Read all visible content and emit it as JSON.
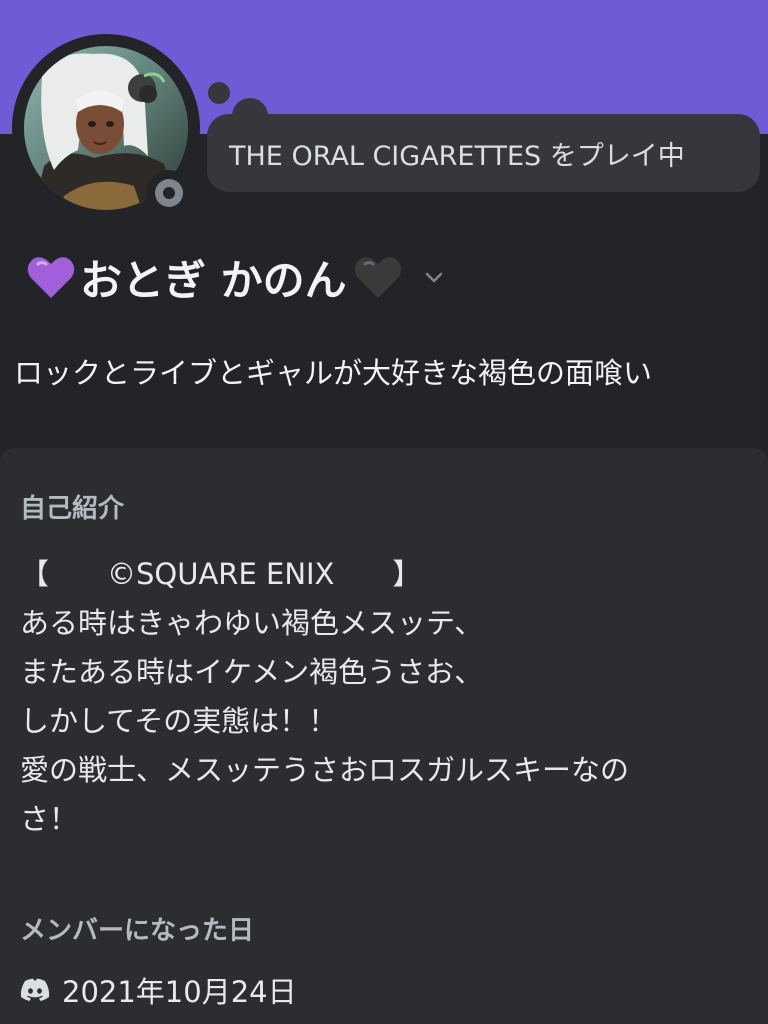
{
  "profile": {
    "activity": "THE ORAL CIGARETTES をプレイ中",
    "display_name": "おとぎ かのん",
    "pronouns": "ロックとライブとギャルが大好きな褐色の面喰い",
    "status": "offline"
  },
  "about": {
    "title": "自己紹介",
    "lines": [
      "【　　©SQUARE ENIX　　】",
      "ある時はきゃわゆい褐色メスッテ、",
      "またある時はイケメン褐色うさお、",
      "しかしてその実態は！！",
      "愛の戦士、メスッテうさおロスガルスキーなの",
      "さ！"
    ]
  },
  "member_since": {
    "title": "メンバーになった日",
    "date": "2021年10月24日"
  },
  "colors": {
    "banner": "#6f5bd6",
    "background": "#232428",
    "card": "#2b2d31",
    "status_offline": "#80848e"
  },
  "icons": {
    "status": "offline-status-icon",
    "purple_heart": "purple-heart-emoji",
    "black_heart": "black-heart-emoji",
    "expand": "chevron-down-icon",
    "discord": "discord-logo-icon"
  }
}
